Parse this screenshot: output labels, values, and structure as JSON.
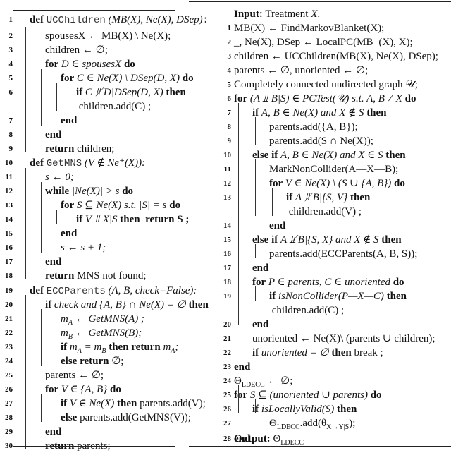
{
  "left_algorithm": {
    "lines": [
      {
        "n": "1",
        "html_key": "l1"
      },
      {
        "n": "2"
      },
      {
        "n": "3"
      },
      {
        "n": "4"
      },
      {
        "n": "5"
      },
      {
        "n": "6"
      },
      {
        "n": ""
      },
      {
        "n": "7"
      },
      {
        "n": "8"
      },
      {
        "n": "9"
      },
      {
        "n": "10"
      },
      {
        "n": "11"
      },
      {
        "n": "12"
      },
      {
        "n": "13"
      },
      {
        "n": "14"
      },
      {
        "n": "15"
      },
      {
        "n": "16"
      },
      {
        "n": "17"
      },
      {
        "n": "18"
      },
      {
        "n": "19"
      },
      {
        "n": "20"
      },
      {
        "n": "21"
      },
      {
        "n": "22"
      },
      {
        "n": "23"
      },
      {
        "n": "24"
      },
      {
        "n": "25"
      },
      {
        "n": "26"
      },
      {
        "n": "27"
      },
      {
        "n": "28"
      },
      {
        "n": "29"
      },
      {
        "n": "30"
      }
    ],
    "text": {
      "def": "def",
      "uc_name": "UCChildren",
      "uc_args": "(MB(X), Ne(X), DSep):",
      "l2": "spousesX ← MB(X) \\ Ne(X);",
      "l3": "children ← ∅;",
      "l4_for": "for",
      "l4_body": "D ∈ spousesX",
      "l4_do": "do",
      "l5_body": "C ∈ Ne(X) \\ DSep(D, X)",
      "l6_if": "if",
      "l6_body": "C ⫫̸ D|DSep(D, X)",
      "then": "then",
      "l6b": "children.add(C) ;",
      "end": "end",
      "return": "return",
      "l9": "children;",
      "mns_name": "GetMNS",
      "mns_args": "(V ∉ Ne⁺(X)):",
      "l11": "s ← 0;",
      "while": "while",
      "l12_body": "|Ne(X)| > s",
      "l13_body": "S ⊆ Ne(X) s.t. |S| = s",
      "l14_body": "V ⫫ X|S",
      "l14_ret": "S ;",
      "l16": "s ← s + 1;",
      "l18": "MNS not found;",
      "ecc_name": "ECCParents",
      "ecc_args": "(A, B, check=False):",
      "l20_body": "check and {A, B} ∩ Ne(X) = ∅",
      "l21": "m_A ← GetMNS(A) ;",
      "l22": "m_B ← GetMNS(B);",
      "l23_body": "m_A = m_B",
      "l23_ret": "m_A;",
      "else": "else",
      "l24_ret": "∅;",
      "l25": "parents ← ∅;",
      "l26_body": "V ∈ {A, B}",
      "l27_body": "V ∈ Ne(X)",
      "l27_act": "parents.add(V);",
      "l28_act": "parents.add(GetMNS(V));",
      "l30": "parents;"
    }
  },
  "right_algorithm": {
    "input_label": "Input:",
    "input_text": "Treatment X.",
    "output_label": "Output:",
    "output_text": "Θ_LDECC",
    "text": {
      "r1": "MB(X) ← FindMarkovBlanket(X);",
      "r2": "_, Ne(X), DSep ← LocalPC(MB⁺(X), X);",
      "r3": "children ← UCChildren(MB(X), Ne(X), DSep);",
      "r4": "parents ← ∅, unoriented ← ∅;",
      "r5": "Completely connected undirected graph 𝒰;",
      "r6_body": "(A ⫫ B|S) ∈ PCTest(𝒰) s.t. A, B ≠ X",
      "r7_body": "A, B ∈ Ne(X) and X ∉ S",
      "r8": "parents.add({A, B});",
      "r9": "parents.add(S ∩ Ne(X));",
      "else_if": "else if",
      "r10_body": "A, B ∈ Ne(X) and X ∈ S",
      "r11": "MarkNonCollider(A—X—B);",
      "r12_body": "V ∈ Ne(X) \\ (S ∪ {A, B})",
      "r13_body": "A ⫫̸ B|{S, V}",
      "r13b": "children.add(V) ;",
      "r15_body": "A ⫫̸ B|{S, X} and X ∉ S",
      "r16": "parents.add(ECCParents(A, B, S));",
      "r18_body": "P ∈ parents, C ∈ unoriented",
      "r19_body": "isNonCollider(P—X—C)",
      "r19b": "children.add(C) ;",
      "r21": "unoriented ← Ne(X)\\ (parents ∪ children);",
      "r22_body": "unoriented = ∅",
      "r22_act": "break ;",
      "r24": "Θ_LDECC ← ∅;",
      "r25_body": "S ⊆ (unoriented ∪ parents)",
      "r26_body": "isLocallyValid(S)",
      "r27": "Θ_LDECC.add(θ_{X→Y|S});"
    }
  }
}
